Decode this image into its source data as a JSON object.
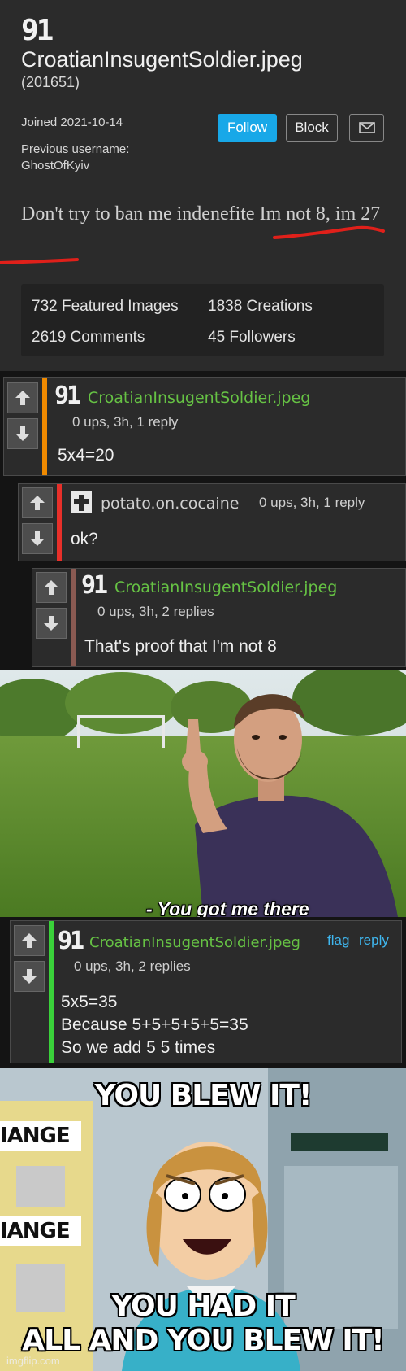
{
  "profile": {
    "avatar_glyph": "91",
    "username": "CroatianInsugentSoldier.jpeg",
    "points": "(201651)",
    "joined": "Joined 2021-10-14",
    "previous_label": "Previous username:",
    "previous_username": "GhostOfKyiv",
    "follow_label": "Follow",
    "block_label": "Block",
    "bio": "Don't try to ban me indenefite Im not 8, im 27",
    "stats": {
      "featured": "732 Featured Images",
      "creations": "1838 Creations",
      "comments": "2619 Comments",
      "followers": "45 Followers"
    }
  },
  "comments": [
    {
      "avatar_glyph": "91",
      "username": "CroatianInsugentSoldier.jpeg",
      "meta": "0 ups, 3h, 1 reply",
      "text": "5x4=20",
      "accent_color": "#f08a00"
    },
    {
      "username": "potato.on.cocaine",
      "meta": "0 ups, 3h, 1 reply",
      "text": "ok?",
      "accent_color": "#e8302a"
    },
    {
      "avatar_glyph": "91",
      "username": "CroatianInsugentSoldier.jpeg",
      "meta": "0 ups, 3h, 2 replies",
      "text": "That's proof that I'm not 8",
      "accent_color": "#8a5a52"
    },
    {
      "avatar_glyph": "91",
      "username": "CroatianInsugentSoldier.jpeg",
      "meta": "0 ups, 3h, 2 replies",
      "flag_label": "flag",
      "reply_label": "reply",
      "text_lines": [
        "5x5=35",
        "Because 5+5+5+5+5=35",
        "So we add 5 5 times"
      ],
      "accent_color": "#3ad13a"
    }
  ],
  "meme_top": {
    "subtitle": "- You got me there"
  },
  "meme_bottom": {
    "caption_top": "YOU BLEW IT!",
    "caption_bottom_line1": "YOU HAD IT",
    "caption_bottom_line2": "ALL AND YOU BLEW IT!",
    "sign_text_1": "IANGE",
    "sign_text_2": "IANGE"
  },
  "watermark": "imgflip.com",
  "colors": {
    "panel_bg": "#2b2b2b",
    "follow_blue": "#18a8e8",
    "username_green": "#66c244",
    "link_blue": "#3fb6ee",
    "underline_red": "#e0201a"
  }
}
